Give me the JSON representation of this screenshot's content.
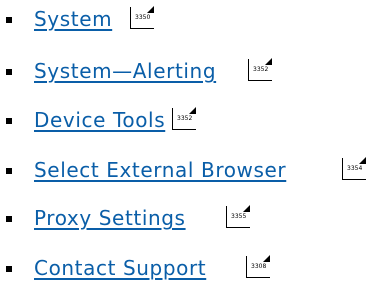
{
  "links": [
    {
      "label": "System",
      "page_ref": "3350"
    },
    {
      "label": "System—Alerting",
      "page_ref": "3352"
    },
    {
      "label": "Device Tools",
      "page_ref": "3352"
    },
    {
      "label": "Select External Browser",
      "page_ref": "3354"
    },
    {
      "label": "Proxy Settings",
      "page_ref": "3355"
    },
    {
      "label": "Contact Support",
      "page_ref": "3308"
    }
  ],
  "colors": {
    "link": "#0a5ea8",
    "bullet": "#000000",
    "background": "#ffffff"
  },
  "icons": {
    "bullet": "square-bullet-icon",
    "page_ref": "page-reference-icon"
  }
}
